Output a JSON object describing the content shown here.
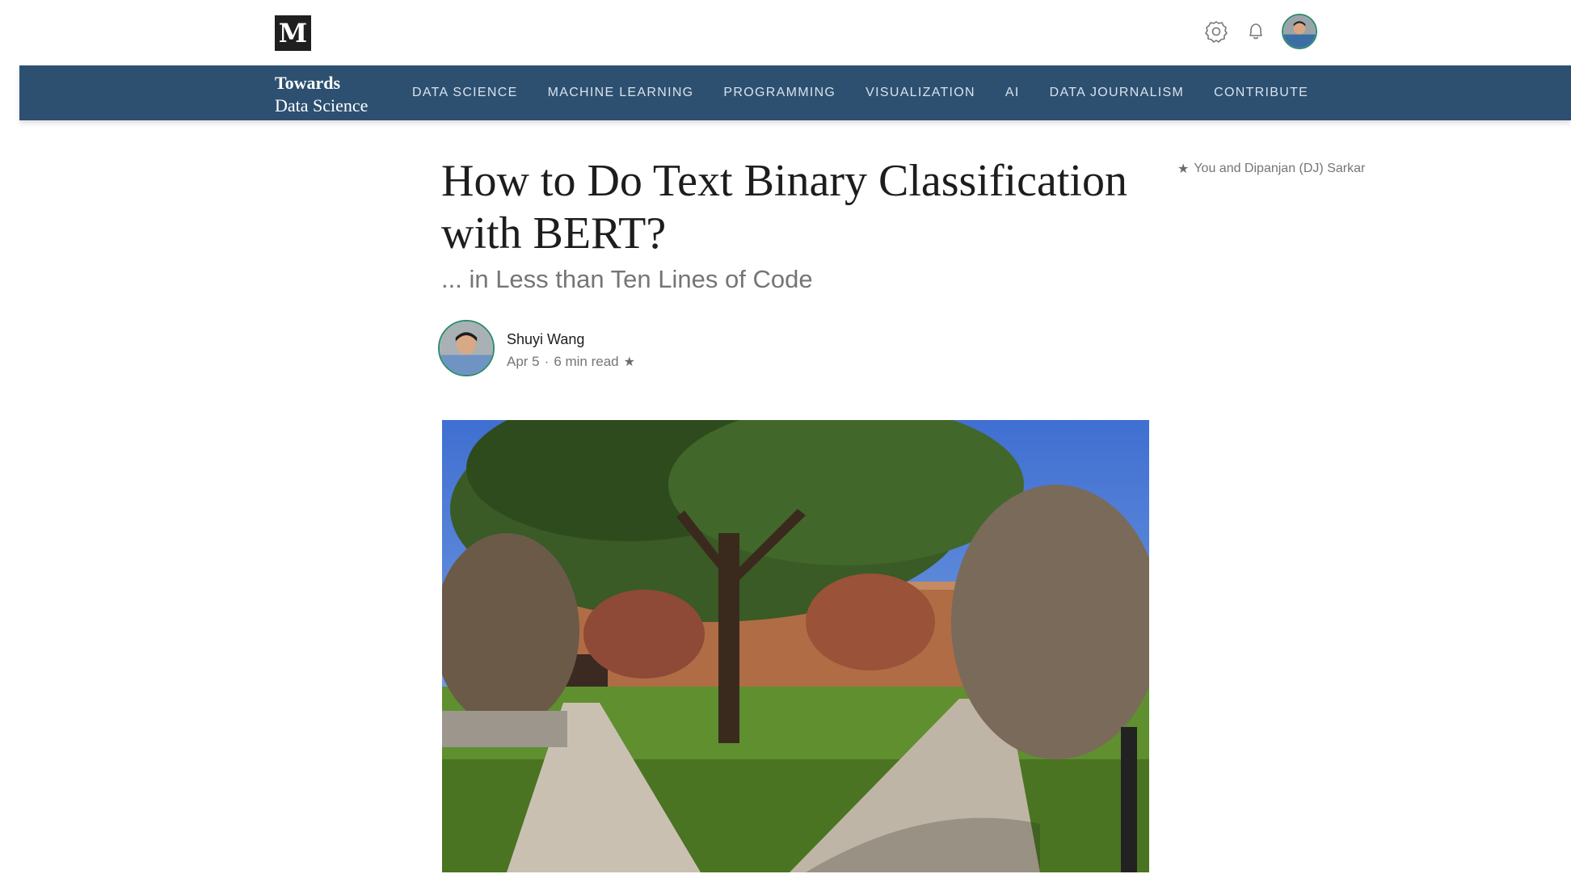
{
  "app": {
    "logo_letter": "M"
  },
  "topbar": {
    "icons": [
      "settings-icon",
      "bell-icon",
      "avatar"
    ]
  },
  "publication": {
    "name_line1": "Towards",
    "name_line2": "Data Science",
    "color": "#2d5071",
    "nav": [
      {
        "label": "DATA SCIENCE"
      },
      {
        "label": "MACHINE LEARNING"
      },
      {
        "label": "PROGRAMMING"
      },
      {
        "label": "VISUALIZATION"
      },
      {
        "label": "AI"
      },
      {
        "label": "DATA JOURNALISM"
      },
      {
        "label": "CONTRIBUTE"
      }
    ]
  },
  "article": {
    "title": "How to Do Text Binary Classification with BERT?",
    "subtitle": "... in Less than Ten Lines of Code",
    "recommended_by": "You and Dipanjan (DJ) Sarkar",
    "author": {
      "name": "Shuyi Wang",
      "date": "Apr 5",
      "separator": "·",
      "read_time": "6 min read"
    },
    "accent_color": "#2e8b6f"
  }
}
